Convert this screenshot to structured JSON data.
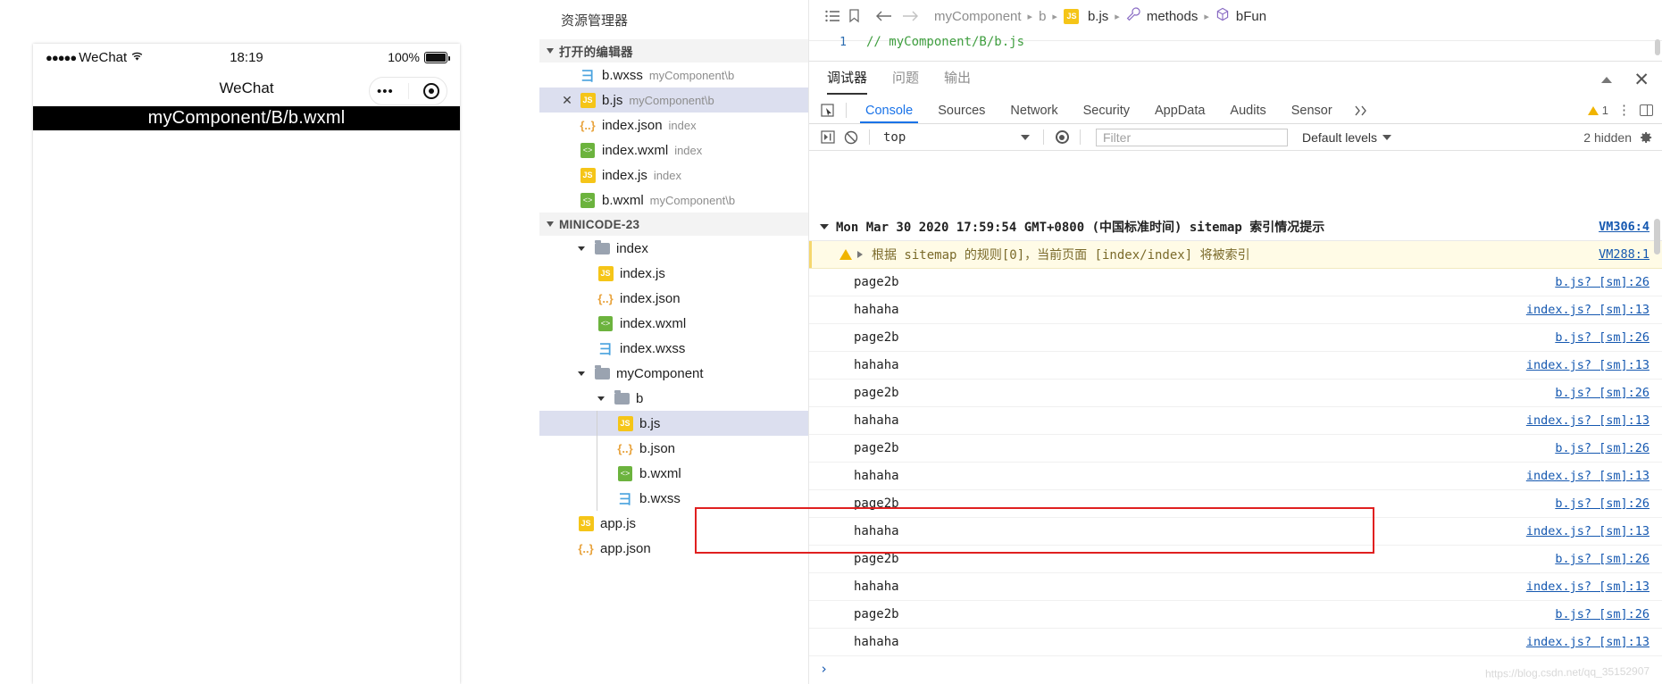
{
  "simulator": {
    "status_bar": {
      "carrier_dots": "●●●●●",
      "carrier": "WeChat",
      "wifi_icon": "wifi-icon",
      "time": "18:19",
      "battery_pct": "100%"
    },
    "nav_bar": {
      "title": "WeChat",
      "capsule_more_icon": "more-dots-icon",
      "capsule_target_icon": "target-icon"
    },
    "page_title": "myComponent/B/b.wxml"
  },
  "explorer": {
    "title": "资源管理器",
    "open_editors": {
      "label": "打开的编辑器",
      "items": [
        {
          "icon": "wxss-file-icon",
          "name": "b.wxss",
          "desc": "myComponent\\b",
          "selected": false,
          "closable": false
        },
        {
          "icon": "js-file-icon",
          "name": "b.js",
          "desc": "myComponent\\b",
          "selected": true,
          "closable": true
        },
        {
          "icon": "json-file-icon",
          "name": "index.json",
          "desc": "index",
          "selected": false,
          "closable": false
        },
        {
          "icon": "wxml-file-icon",
          "name": "index.wxml",
          "desc": "index",
          "selected": false,
          "closable": false
        },
        {
          "icon": "js-file-icon",
          "name": "index.js",
          "desc": "index",
          "selected": false,
          "closable": false
        },
        {
          "icon": "wxml-file-icon",
          "name": "b.wxml",
          "desc": "myComponent\\b",
          "selected": false,
          "closable": false
        }
      ]
    },
    "project": {
      "label": "MINICODE-23",
      "tree": [
        {
          "depth": 1,
          "type": "folder",
          "name": "index",
          "expanded": true
        },
        {
          "depth": 2,
          "type": "js",
          "name": "index.js"
        },
        {
          "depth": 2,
          "type": "json",
          "name": "index.json"
        },
        {
          "depth": 2,
          "type": "wxml",
          "name": "index.wxml"
        },
        {
          "depth": 2,
          "type": "wxss",
          "name": "index.wxss"
        },
        {
          "depth": 1,
          "type": "folder",
          "name": "myComponent",
          "expanded": true
        },
        {
          "depth": 2,
          "type": "folder",
          "name": "b",
          "expanded": true
        },
        {
          "depth": 3,
          "type": "js",
          "name": "b.js",
          "selected": true
        },
        {
          "depth": 3,
          "type": "json",
          "name": "b.json"
        },
        {
          "depth": 3,
          "type": "wxml",
          "name": "b.wxml"
        },
        {
          "depth": 3,
          "type": "wxss",
          "name": "b.wxss"
        },
        {
          "depth": 1,
          "type": "js",
          "name": "app.js"
        },
        {
          "depth": 1,
          "type": "json",
          "name": "app.json"
        }
      ]
    }
  },
  "editor": {
    "toolbar_icons": [
      "list-icon",
      "bookmark-icon",
      "back-arrow-icon",
      "forward-arrow-icon"
    ],
    "breadcrumb": [
      {
        "label": "myComponent",
        "icon": null
      },
      {
        "label": "b",
        "icon": null
      },
      {
        "label": "b.js",
        "icon": "js-file-icon"
      },
      {
        "label": "methods",
        "icon": "wrench-icon"
      },
      {
        "label": "bFun",
        "icon": "cube-icon"
      }
    ],
    "line_number": "1",
    "code": "// myComponent/B/b.js"
  },
  "devtools": {
    "panel_tabs": [
      {
        "label": "调试器",
        "active": true
      },
      {
        "label": "问题",
        "active": false
      },
      {
        "label": "输出",
        "active": false
      }
    ],
    "panel_actions": {
      "collapse_icon": "chevron-up-icon",
      "close_icon": "close-icon"
    },
    "tabs": [
      {
        "label": "Console",
        "active": true
      },
      {
        "label": "Sources",
        "active": false
      },
      {
        "label": "Network",
        "active": false
      },
      {
        "label": "Security",
        "active": false
      },
      {
        "label": "AppData",
        "active": false
      },
      {
        "label": "Audits",
        "active": false
      },
      {
        "label": "Sensor",
        "active": false
      }
    ],
    "more_tabs_icon": "chevrons-right-icon",
    "warning_count": "1",
    "kebab_icon": "more-vertical-icon",
    "dock_icon": "dock-side-icon",
    "console_toolbar": {
      "execute_icon": "execute-icon",
      "clear_icon": "clear-console-icon",
      "context": "top",
      "eye_icon": "live-expression-icon",
      "filter_placeholder": "Filter",
      "levels": "Default levels",
      "hidden": "2 hidden",
      "gear_icon": "settings-icon"
    },
    "console_rows": [
      {
        "kind": "group",
        "text": "Mon Mar 30 2020 17:59:54 GMT+0800 (中国标准时间) sitemap 索引情况提示",
        "source": "VM306:4"
      },
      {
        "kind": "warn",
        "text": "根据 sitemap 的规则[0]，当前页面 [index/index] 将被索引",
        "source": "VM288:1"
      },
      {
        "kind": "log",
        "text": "page2b",
        "source": "b.js? [sm]:26"
      },
      {
        "kind": "log",
        "text": "hahaha",
        "source": "index.js? [sm]:13"
      },
      {
        "kind": "log",
        "text": "page2b",
        "source": "b.js? [sm]:26"
      },
      {
        "kind": "log",
        "text": "hahaha",
        "source": "index.js? [sm]:13"
      },
      {
        "kind": "log",
        "text": "page2b",
        "source": "b.js? [sm]:26"
      },
      {
        "kind": "log",
        "text": "hahaha",
        "source": "index.js? [sm]:13"
      },
      {
        "kind": "log",
        "text": "page2b",
        "source": "b.js? [sm]:26"
      },
      {
        "kind": "log",
        "text": "hahaha",
        "source": "index.js? [sm]:13"
      },
      {
        "kind": "log",
        "text": "page2b",
        "source": "b.js? [sm]:26"
      },
      {
        "kind": "log",
        "text": "hahaha",
        "source": "index.js? [sm]:13"
      },
      {
        "kind": "log",
        "text": "page2b",
        "source": "b.js? [sm]:26"
      },
      {
        "kind": "log",
        "text": "hahaha",
        "source": "index.js? [sm]:13"
      },
      {
        "kind": "log",
        "text": "page2b",
        "source": "b.js? [sm]:26",
        "highlighted": true
      },
      {
        "kind": "log",
        "text": "hahaha",
        "source": "index.js? [sm]:13",
        "highlighted": true
      }
    ],
    "prompt": "›"
  },
  "watermark": "https://blog.csdn.net/qq_35152907",
  "colors": {
    "accent_blue": "#1a73e8",
    "link_blue": "#1558b0",
    "warning_yellow": "#f0b400",
    "warn_bg": "#fffbe6",
    "selection": "#dcdfef",
    "highlight_box": "#e02020"
  }
}
